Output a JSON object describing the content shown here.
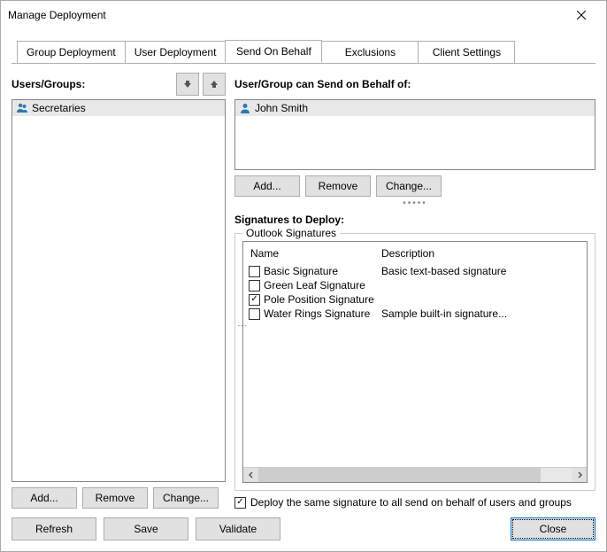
{
  "window": {
    "title": "Manage Deployment"
  },
  "tabs": [
    {
      "label": "Group Deployment",
      "active": false
    },
    {
      "label": "User Deployment",
      "active": false
    },
    {
      "label": "Send On Behalf",
      "active": true
    },
    {
      "label": "Exclusions",
      "active": false
    },
    {
      "label": "Client Settings",
      "active": false
    }
  ],
  "left": {
    "label": "Users/Groups:",
    "items": [
      {
        "name": "Secretaries",
        "type": "group",
        "selected": true
      }
    ],
    "buttons": {
      "add": "Add...",
      "remove": "Remove",
      "change": "Change..."
    }
  },
  "right": {
    "behalf_label": "User/Group can Send on Behalf of:",
    "behalf_items": [
      {
        "name": "John Smith",
        "type": "user",
        "selected": true
      }
    ],
    "behalf_buttons": {
      "add": "Add...",
      "remove": "Remove",
      "change": "Change..."
    },
    "sigs_label": "Signatures to Deploy:",
    "fieldset_label": "Outlook Signatures",
    "columns": {
      "name": "Name",
      "desc": "Description"
    },
    "signatures": [
      {
        "name": "Basic Signature",
        "desc": "Basic text-based signature",
        "checked": false
      },
      {
        "name": "Green Leaf Signature",
        "desc": "",
        "checked": false
      },
      {
        "name": "Pole Position Signature",
        "desc": "",
        "checked": true
      },
      {
        "name": "Water Rings Signature",
        "desc": "Sample built-in signature...",
        "checked": false
      }
    ],
    "deploy_all": {
      "checked": true,
      "label": "Deploy the same signature to all send on behalf of users and groups"
    }
  },
  "footer": {
    "refresh": "Refresh",
    "save": "Save",
    "validate": "Validate",
    "close": "Close"
  }
}
